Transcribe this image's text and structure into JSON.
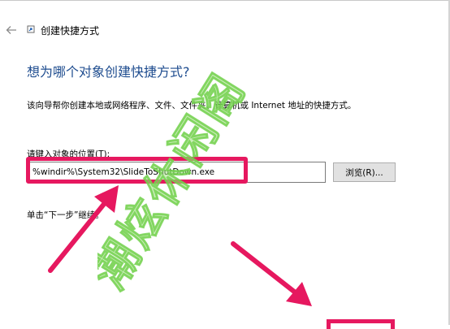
{
  "dialog": {
    "title": "创建快捷方式",
    "heading": "想为哪个对象创建快捷方式?",
    "description": "该向导帮你创建本地或网络程序、文件、文件夹、计算机或 Internet 地址的快捷方式。",
    "location_label": "请键入对象的位置(T):",
    "location_value": "%windir%\\System32\\SlideToShutDown.exe",
    "browse_label": "浏览(R)...",
    "hint": "单击“下一步”继续。"
  },
  "watermark": {
    "text": "潮炫休闲阁"
  },
  "colors": {
    "heading": "#1e4c8f",
    "annotation": "#e6185f",
    "watermark": "#6fcf4a"
  },
  "icons": [
    "back-arrow-icon",
    "shortcut-wizard-icon"
  ]
}
